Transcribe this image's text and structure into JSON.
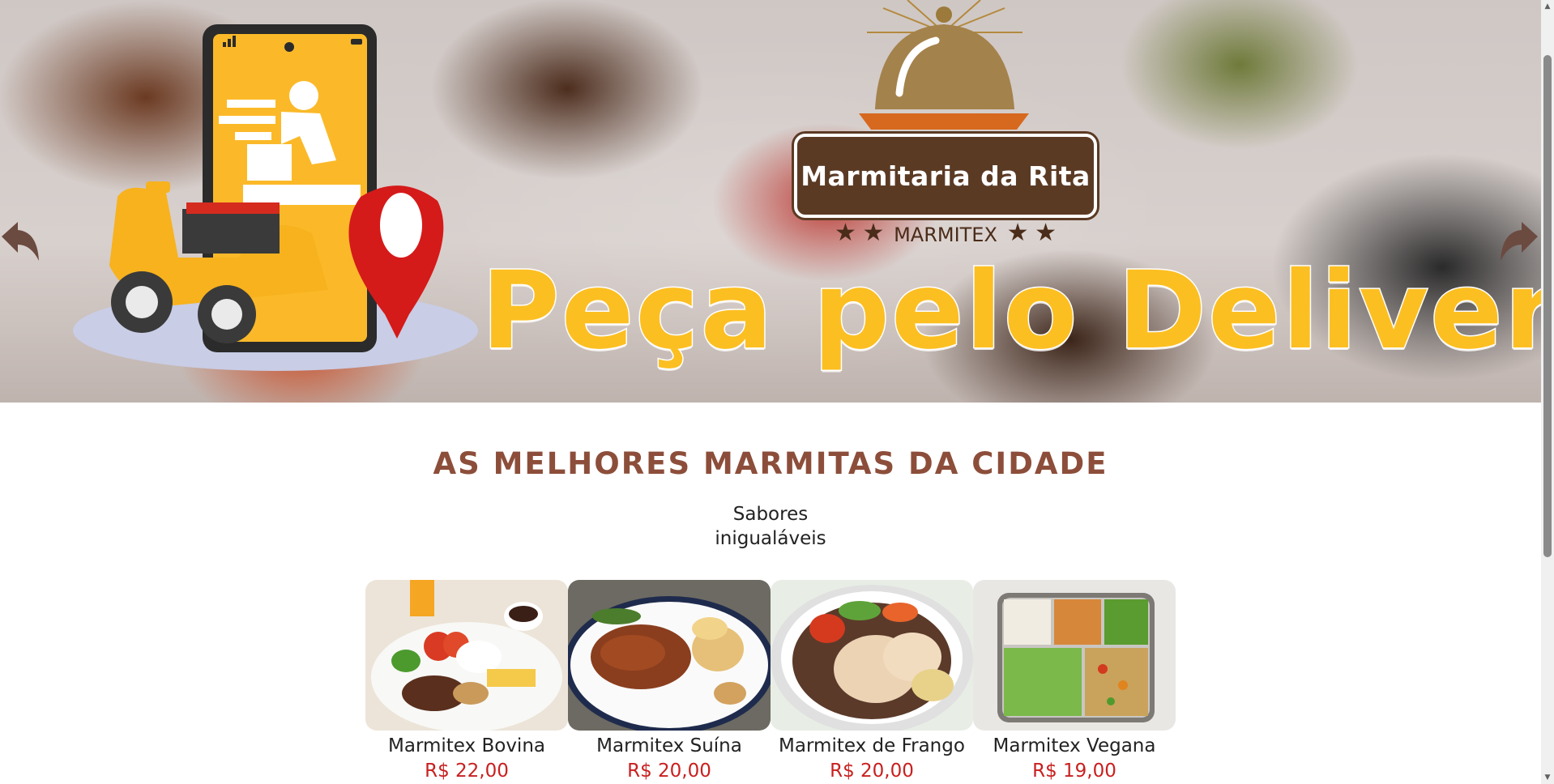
{
  "hero": {
    "logo_name": "Marmitaria da Rita",
    "logo_sub": "MARMITEX",
    "headline": "Peça pelo Delivery!"
  },
  "section": {
    "title": "AS MELHORES MARMITAS DA CIDADE",
    "subtitle": "Sabores inigualáveis"
  },
  "products": [
    {
      "name": "Marmitex Bovina",
      "price": "R$ 22,00"
    },
    {
      "name": "Marmitex Suína",
      "price": "R$ 20,00"
    },
    {
      "name": "Marmitex de Frango",
      "price": "R$ 20,00"
    },
    {
      "name": "Marmitex Vegana",
      "price": "R$ 19,00"
    }
  ],
  "colors": {
    "headline": "#fcbf22",
    "title": "#8c4e3a",
    "price": "#c8201f",
    "logo_brown": "#5b3a24"
  },
  "icons": {
    "prev": "arrow-left-icon",
    "next": "arrow-right-icon"
  }
}
